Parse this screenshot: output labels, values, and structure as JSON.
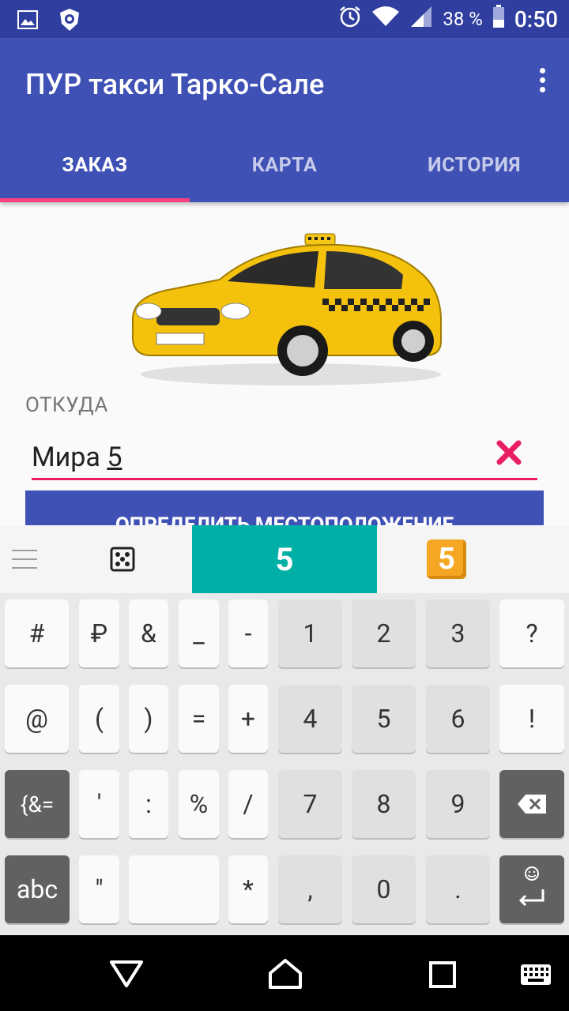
{
  "status": {
    "battery": "38 %",
    "time": "0:50"
  },
  "app": {
    "title": "ПУР такси Тарко-Сале"
  },
  "tabs": [
    "ЗАКАЗ",
    "КАРТА",
    "ИСТОРИЯ"
  ],
  "form": {
    "from_label": "ОТКУДА",
    "address_text": "Мира ",
    "address_number": "5",
    "locate_button": "ОПРЕДЕЛИТЬ МЕСТОПОЛОЖЕНИЕ"
  },
  "suggestion": {
    "word": "5",
    "emoji_label": "5"
  },
  "keyboard": {
    "row1": [
      "#",
      "₽",
      "&",
      "_",
      "-",
      "1",
      "2",
      "3",
      "?"
    ],
    "row2": [
      "@",
      "(",
      ")",
      "=",
      "+",
      "4",
      "5",
      "6",
      "!"
    ],
    "row3": [
      "{&=",
      "'",
      ":",
      "%",
      "/",
      "7",
      "8",
      "9"
    ],
    "row4": [
      "abc",
      "\"",
      "",
      "*",
      ",",
      "0",
      "."
    ]
  },
  "colors": {
    "primary": "#3f51b5",
    "primary_dark": "#303f9f",
    "accent": "#ff4081",
    "suggest": "#00b0a6"
  },
  "icons": [
    "image-icon",
    "shield-icon",
    "alarm-icon",
    "wifi-icon",
    "signal-icon",
    "battery-icon",
    "overflow-menu-icon",
    "clear-icon",
    "menu-lines-icon",
    "dice-icon",
    "emoji-5-icon",
    "backspace-icon",
    "enter-icon",
    "back-nav-icon",
    "home-nav-icon",
    "recents-nav-icon",
    "keyboard-icon"
  ]
}
